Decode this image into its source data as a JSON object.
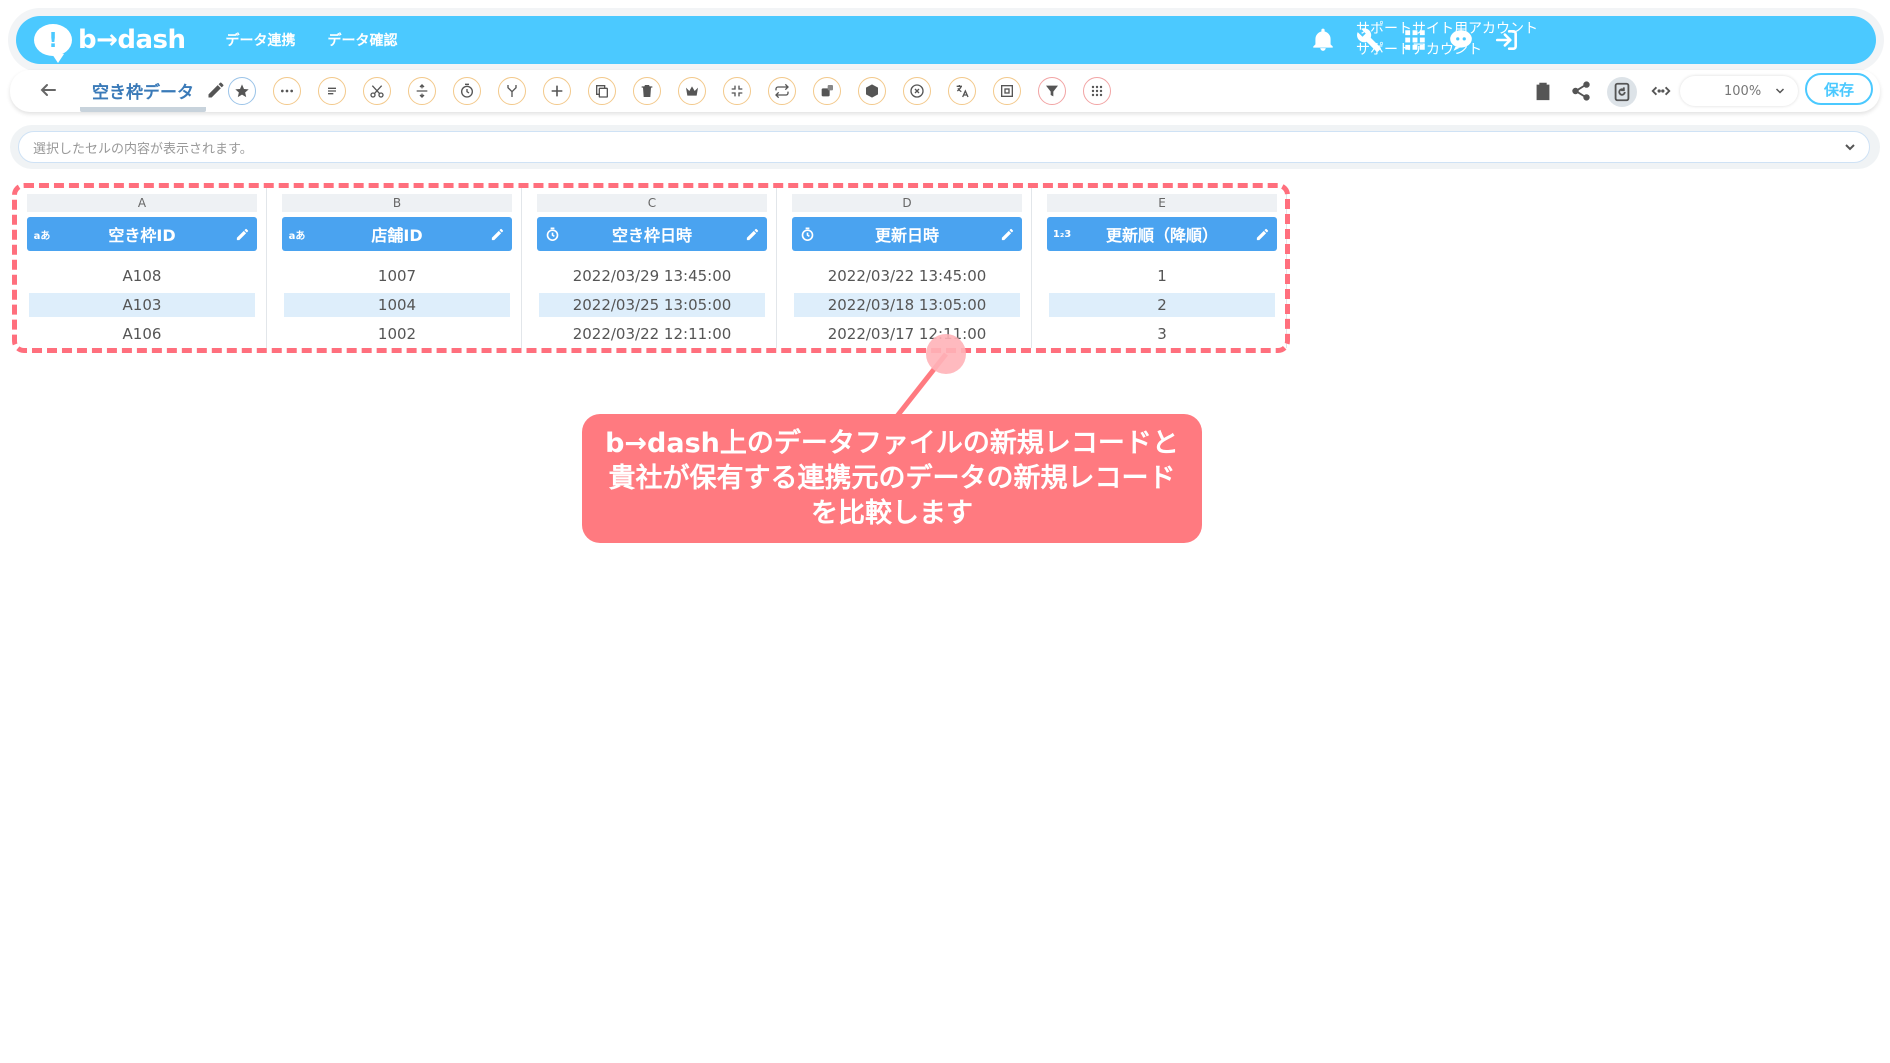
{
  "header": {
    "logo_mark": "!",
    "logo_text": "b→dash",
    "nav": [
      "データ連携",
      "データ確認"
    ],
    "account_line1": "サポートサイト用アカウント",
    "account_line2": "サポートアカウント",
    "icons": [
      "bell-icon",
      "wrench-icon",
      "apps-grid-icon",
      "chat-bot-icon",
      "logout-icon"
    ]
  },
  "toolbar": {
    "file_name": "空き枠データ",
    "tool_icons": [
      "star-icon",
      "more-dots-icon",
      "lines-icon",
      "scissors-icon",
      "expand-cross-icon",
      "timer-icon",
      "merge-icon",
      "plus-icon",
      "copy-icon",
      "trash-icon",
      "crown-icon",
      "shrink-icon",
      "repeat-icon",
      "dice-icon",
      "cube-icon",
      "close-circle-icon",
      "translate-icon",
      "frame-icon",
      "filter-icon",
      "grid-dots-icon"
    ],
    "right_icons": [
      "clipboard-icon",
      "share-icon",
      "refresh-doc-icon",
      "code-arrows-icon"
    ],
    "zoom": "100%",
    "save_label": "保存"
  },
  "cell_bar": {
    "placeholder": "選択したセルの内容が表示されます。"
  },
  "grid": {
    "columns": [
      {
        "letter": "A",
        "type": "text",
        "type_label": "aあ",
        "name": "空き枠ID",
        "values": [
          "A108",
          "A103",
          "A106"
        ]
      },
      {
        "letter": "B",
        "type": "text",
        "type_label": "aあ",
        "name": "店舗ID",
        "values": [
          "1007",
          "1004",
          "1002"
        ]
      },
      {
        "letter": "C",
        "type": "datetime",
        "type_label": "",
        "name": "空き枠日時",
        "values": [
          "2022/03/29 13:45:00",
          "2022/03/25 13:05:00",
          "2022/03/22 12:11:00"
        ]
      },
      {
        "letter": "D",
        "type": "datetime",
        "type_label": "",
        "name": "更新日時",
        "values": [
          "2022/03/22 13:45:00",
          "2022/03/18 13:05:00",
          "2022/03/17 12:11:00"
        ]
      },
      {
        "letter": "E",
        "type": "number",
        "type_label": "1₂3",
        "name": "更新順（降順）",
        "values": [
          "1",
          "2",
          "3"
        ]
      }
    ]
  },
  "callout": {
    "line1": "b→dash上のデータファイルの新規レコードと",
    "line2": "貴社が保有する連携元のデータの新規レコード",
    "line3": "を比較します",
    "color": "#ff7a80"
  },
  "colors": {
    "brand": "#4bc9ff",
    "column_header": "#4aa3f0",
    "alt_row": "#deeefb",
    "highlight_frame": "#ff6f7d"
  }
}
